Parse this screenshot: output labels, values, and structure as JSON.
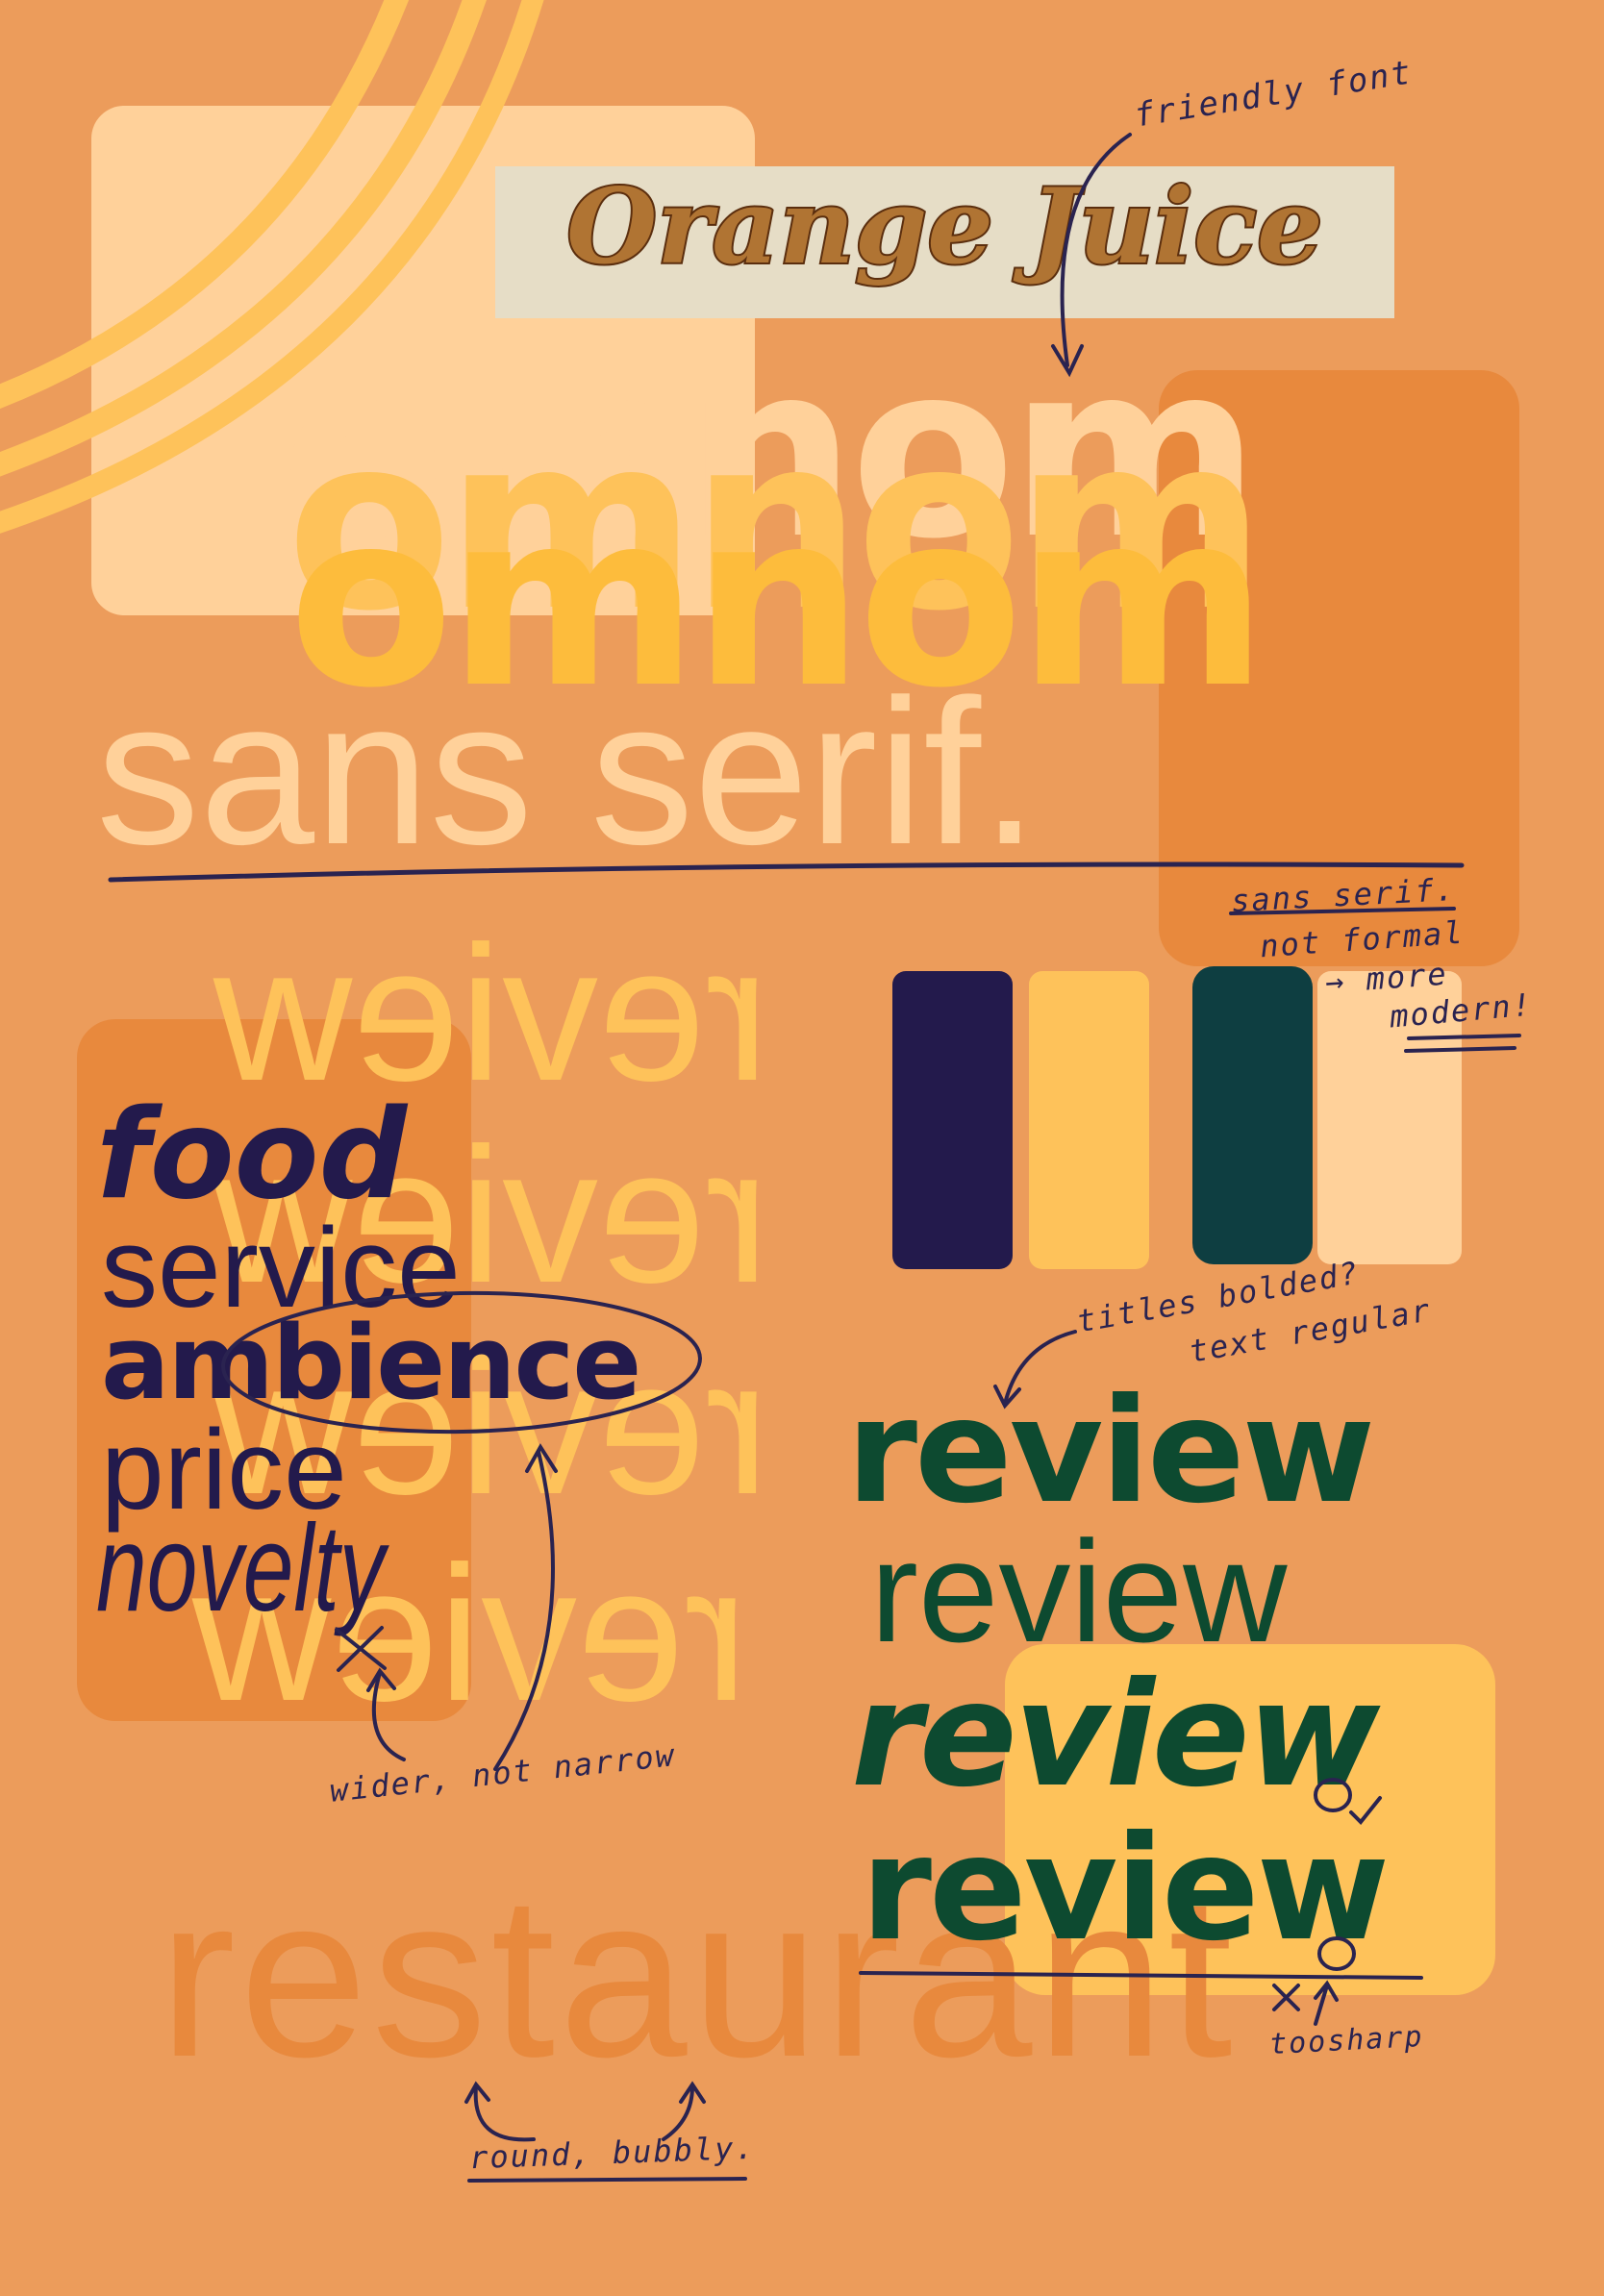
{
  "colors": {
    "background": "#EC9C5B",
    "cream": "#FFD19A",
    "deep_orange": "#E8893D",
    "yellow": "#FEC25A",
    "bright_yellow": "#FDBC3C",
    "navy": "#231A4C",
    "teal": "#0E3E41",
    "forest": "#0D4A30",
    "ink": "#2A2350"
  },
  "title_logo": {
    "text": "Orange Juice",
    "bg": "#E6DDC6",
    "fill": "#B07433",
    "outline": "#5B2E0E"
  },
  "omnom": {
    "text": "omnom"
  },
  "sans_serif": {
    "text": "sans serif."
  },
  "mirrored_review": {
    "text": "review"
  },
  "watermark": {
    "text": "restaurant"
  },
  "word_list": {
    "items": [
      "food",
      "service",
      "ambience",
      "price",
      "novelty"
    ]
  },
  "review_stack": {
    "items": [
      "review",
      "review",
      "review",
      "review"
    ]
  },
  "swatches": [
    "#231A4C",
    "#FEC25A",
    "#0E3E41",
    "#FFD19A"
  ],
  "annotations": {
    "friendly_font": "friendly font",
    "sans_serif_note": "sans serif.",
    "not_formal": "not formal",
    "more": "→ more",
    "modern": "modern!",
    "titles_bolded": "titles bolded?",
    "text_regular": "text regular",
    "wider_not_narrow": "wider, not narrow",
    "too_sharp": "toosharp",
    "round_bubbly": "round, bubbly."
  }
}
